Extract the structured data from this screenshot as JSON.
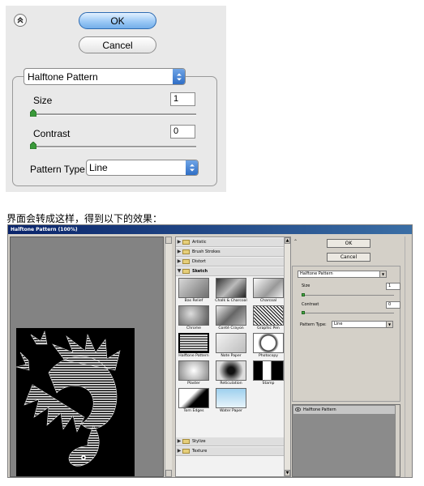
{
  "dialog": {
    "ok_label": "OK",
    "cancel_label": "Cancel",
    "filter_selected": "Halftone Pattern",
    "params": {
      "size": {
        "label": "Size",
        "value": "1"
      },
      "contrast": {
        "label": "Contrast",
        "value": "0"
      },
      "pattern_type": {
        "label": "Pattern Type:",
        "value": "Line"
      }
    }
  },
  "caption": "界面会转成这样，得到以下的效果：",
  "gallery": {
    "title": "Halftone Pattern (100%)",
    "categories": {
      "artistic": "Artistic",
      "brush_strokes": "Brush Strokes",
      "distort": "Distort",
      "sketch": "Sketch",
      "stylize": "Stylize",
      "texture": "Texture"
    },
    "thumbnails": {
      "t1": "Bas Relief",
      "t2": "Chalk & Charcoal",
      "t3": "Charcoal",
      "t4": "Chrome",
      "t5": "Conté Crayon",
      "t6": "Graphic Pen",
      "t7": "Halftone Pattern",
      "t8": "Note Paper",
      "t9": "Photocopy",
      "t10": "Plaster",
      "t11": "Reticulation",
      "t12": "Stamp",
      "t13": "Torn Edges",
      "t14": "Water Paper"
    },
    "right": {
      "ok_label": "OK",
      "cancel_label": "Cancel",
      "filter_selected": "Halftone Pattern",
      "size_label": "Size",
      "size_value": "1",
      "contrast_label": "Contrast",
      "contrast_value": "0",
      "pattern_type_label": "Pattern Type:",
      "pattern_type_value": "Line",
      "layer_name": "Halftone Pattern"
    }
  },
  "colors": {
    "ok_button": "#9cc9f6",
    "select_arrows": "#2f6ec6",
    "titlebar": "#0a246a",
    "preview_bg": "#838383"
  }
}
